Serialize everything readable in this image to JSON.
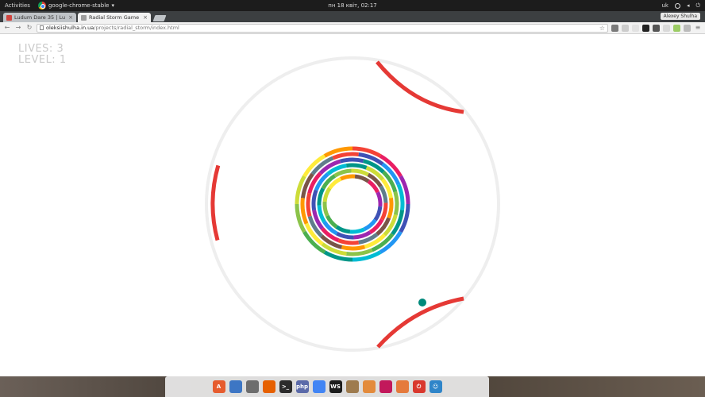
{
  "topbar": {
    "activities": "Activities",
    "app_name": "google-chrome-stable",
    "clock": "пн 18 квіт, 02:17",
    "keyboard": "uk"
  },
  "browser": {
    "profile_name": "Alexey Shulha",
    "tabs": [
      {
        "label": "Ludum Dare 35 | Lu",
        "favicon_color": "#d0443e"
      },
      {
        "label": "Radial Storm Game",
        "favicon_color": "#9e9e9e"
      }
    ],
    "address": {
      "host": "oleksiishulha.in.ua",
      "path": "/projects/radial_storm/index.html"
    }
  },
  "hud": {
    "lives_label": "LIVES: 3",
    "level_label": "LEVEL: 1"
  },
  "game": {
    "colors": {
      "outer_ring": "#eeeeee",
      "paddle": "#e53935",
      "ball": "#00897b"
    },
    "spectrum": [
      "#f44336",
      "#e91e63",
      "#9c27b0",
      "#3f51b5",
      "#2196f3",
      "#00bcd4",
      "#009688",
      "#4caf50",
      "#8bc34a",
      "#cddc39",
      "#ffeb3b",
      "#ff9800",
      "#795548",
      "#607d8b"
    ]
  },
  "dock": {
    "icon_names": [
      "software-center-icon",
      "files-icon",
      "calculator-icon",
      "firefox-icon",
      "terminal-icon",
      "php-icon",
      "chrome-icon",
      "webstorm-icon",
      "archive-icon",
      "folder-icon",
      "video-icon",
      "photo-icon",
      "power-icon",
      "accessibility-icon"
    ],
    "icon_colors": [
      "#e65c2e",
      "#3d76c4",
      "#6d6d6d",
      "#e66000",
      "#2b2b2b",
      "#5b6aa9",
      "#4285f4",
      "#1c1c1c",
      "#9e7b4e",
      "#e38b3c",
      "#c2185b",
      "#e57a3c",
      "#d9382d",
      "#2f85c9"
    ],
    "icon_glyphs": [
      "A",
      "",
      "",
      "",
      "&gt;_",
      "php",
      "",
      "WS",
      "",
      "",
      "",
      "",
      "⏻",
      "☺"
    ]
  }
}
